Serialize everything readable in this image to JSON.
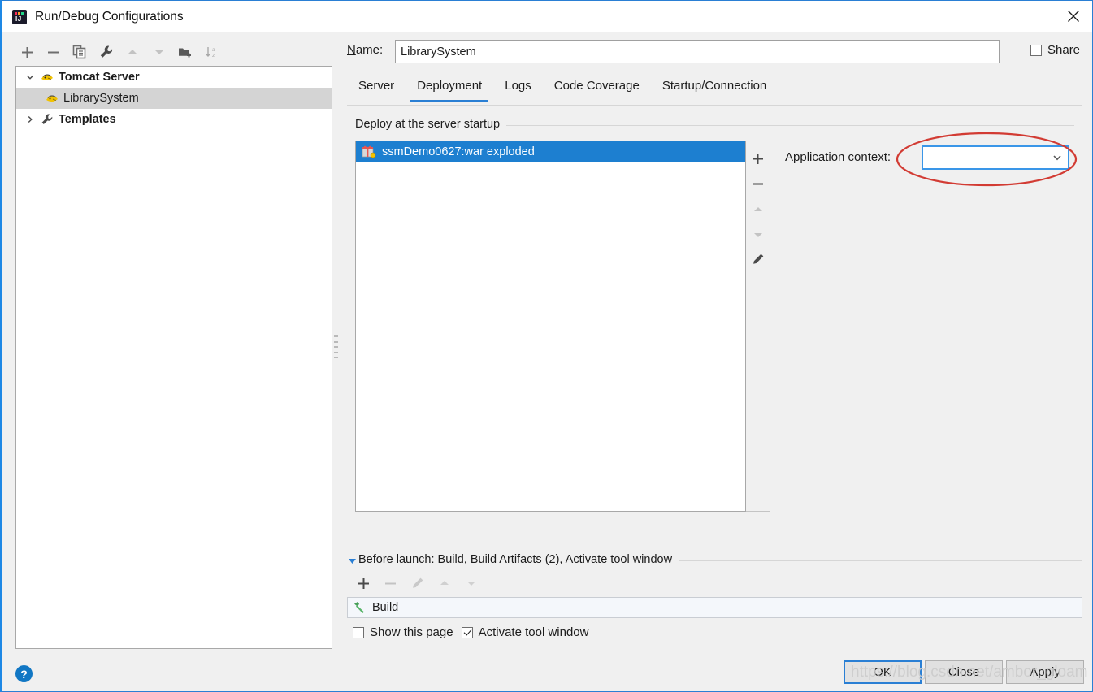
{
  "window": {
    "title": "Run/Debug Configurations",
    "app_icon": "intellij-idea-icon",
    "close_icon": "close-icon"
  },
  "left_toolbar": {
    "buttons": [
      {
        "name": "add-configuration-button",
        "icon": "plus-icon"
      },
      {
        "name": "remove-configuration-button",
        "icon": "minus-icon"
      },
      {
        "name": "copy-configuration-button",
        "icon": "copy-icon"
      },
      {
        "name": "edit-templates-button",
        "icon": "wrench-icon"
      },
      {
        "name": "move-up-button",
        "icon": "arrow-up-icon"
      },
      {
        "name": "move-down-button",
        "icon": "arrow-down-icon"
      },
      {
        "name": "new-folder-button",
        "icon": "folder-add-icon"
      },
      {
        "name": "sort-alphabetically-button",
        "icon": "sort-az-icon"
      }
    ]
  },
  "tree": {
    "items": [
      {
        "label": "Tomcat Server",
        "icon": "tomcat-icon",
        "expander": "chevron-down-icon",
        "level": 0,
        "bold": true,
        "selected": false
      },
      {
        "label": "LibrarySystem",
        "icon": "tomcat-icon",
        "expander": "",
        "level": 1,
        "bold": false,
        "selected": true
      },
      {
        "label": "Templates",
        "icon": "wrench-icon",
        "expander": "chevron-right-icon",
        "level": 0,
        "bold": true,
        "selected": false
      }
    ]
  },
  "name_field": {
    "label": "Name:",
    "label_mnemonic": "N",
    "value": "LibrarySystem",
    "placeholder": ""
  },
  "share": {
    "label": "Share",
    "label_mnemonic": "S",
    "checked": false
  },
  "tabs": [
    {
      "label": "Server",
      "active": false
    },
    {
      "label": "Deployment",
      "active": true
    },
    {
      "label": "Logs",
      "active": false
    },
    {
      "label": "Code Coverage",
      "active": false
    },
    {
      "label": "Startup/Connection",
      "active": false
    }
  ],
  "deployment": {
    "group_title": "Deploy at the server startup",
    "items": [
      {
        "label": "ssmDemo0627:war exploded",
        "icon": "artifact-icon",
        "selected": true
      }
    ],
    "side_buttons": [
      {
        "name": "add-artifact-button",
        "icon": "plus-icon",
        "enabled": true
      },
      {
        "name": "remove-artifact-button",
        "icon": "minus-icon",
        "enabled": true
      },
      {
        "name": "move-artifact-up-button",
        "icon": "arrow-up-icon",
        "enabled": false
      },
      {
        "name": "move-artifact-down-button",
        "icon": "arrow-down-icon",
        "enabled": false
      },
      {
        "name": "edit-artifact-button",
        "icon": "pencil-icon",
        "enabled": true
      }
    ],
    "application_context": {
      "label": "Application context:",
      "value": "",
      "placeholder": "",
      "focused": true,
      "dropdown_icon": "chevron-down-icon"
    }
  },
  "before_launch": {
    "expander_icon": "triangle-down-icon",
    "title": "Before launch: Build, Build Artifacts (2), Activate tool window",
    "title_mnemonic": "B",
    "toolbar": [
      {
        "name": "add-task-button",
        "icon": "plus-icon",
        "enabled": true
      },
      {
        "name": "remove-task-button",
        "icon": "minus-icon",
        "enabled": false
      },
      {
        "name": "edit-task-button",
        "icon": "pencil-icon",
        "enabled": false
      },
      {
        "name": "move-task-up-button",
        "icon": "arrow-up-icon",
        "enabled": false
      },
      {
        "name": "move-task-down-button",
        "icon": "arrow-down-icon",
        "enabled": false
      }
    ],
    "tasks": [
      {
        "label": "Build",
        "icon": "build-hammer-icon"
      }
    ],
    "options": [
      {
        "label": "Show this page",
        "checked": false,
        "name": "show-this-page-checkbox"
      },
      {
        "label": "Activate tool window",
        "checked": true,
        "name": "activate-tool-window-checkbox"
      }
    ]
  },
  "footer": {
    "help_label": "?",
    "buttons": [
      {
        "label": "OK",
        "name": "ok-button",
        "default": true
      },
      {
        "label": "Close",
        "name": "close-button",
        "default": false
      },
      {
        "label": "Apply",
        "name": "apply-button",
        "default": false
      }
    ]
  },
  "watermark": {
    "text": "https://blog.csdn.net/ambor_gloam"
  },
  "colors": {
    "accent": "#2a7fd4",
    "selection": "#1d7fd0",
    "tree_selection": "#d4d4d4",
    "annotation": "#d23b33",
    "dialog_bg": "#f0f0f0"
  }
}
